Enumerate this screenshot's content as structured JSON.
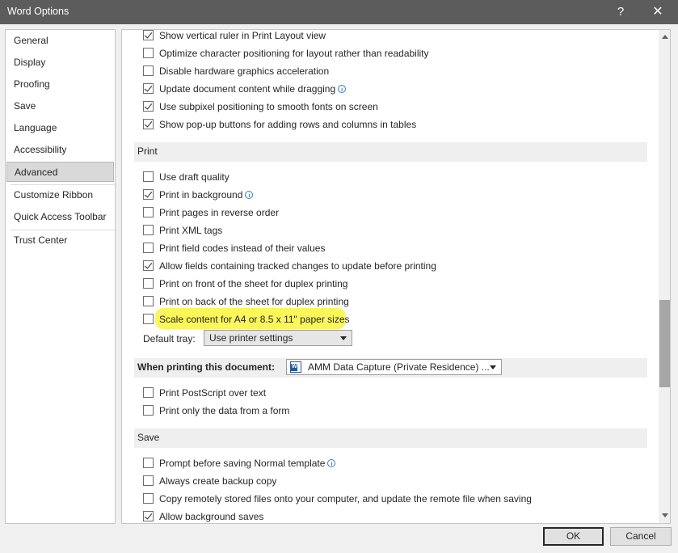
{
  "window": {
    "title": "Word Options",
    "help_glyph": "?",
    "close_glyph": "✕"
  },
  "sidebar": {
    "items": [
      {
        "label": "General",
        "active": false
      },
      {
        "label": "Display",
        "active": false
      },
      {
        "label": "Proofing",
        "active": false
      },
      {
        "label": "Save",
        "active": false
      },
      {
        "label": "Language",
        "active": false
      },
      {
        "label": "Accessibility",
        "active": false
      },
      {
        "label": "Advanced",
        "active": true
      },
      {
        "label": "Customize Ribbon",
        "active": false
      },
      {
        "label": "Quick Access Toolbar",
        "active": false
      },
      {
        "label": "Trust Center",
        "active": false
      }
    ]
  },
  "display_options": [
    {
      "label": "Show vertical ruler in Print Layout view",
      "checked": true,
      "info": false
    },
    {
      "label": "Optimize character positioning for layout rather than readability",
      "checked": false,
      "info": false
    },
    {
      "label": "Disable hardware graphics acceleration",
      "checked": false,
      "info": false
    },
    {
      "label": "Update document content while dragging",
      "checked": true,
      "info": true
    },
    {
      "label": "Use subpixel positioning to smooth fonts on screen",
      "checked": true,
      "info": false
    },
    {
      "label": "Show pop-up buttons for adding rows and columns in tables",
      "checked": true,
      "info": false
    }
  ],
  "print_section": {
    "heading": "Print",
    "options": [
      {
        "label": "Use draft quality",
        "checked": false,
        "info": false
      },
      {
        "label": "Print in background",
        "checked": true,
        "info": true
      },
      {
        "label": "Print pages in reverse order",
        "checked": false,
        "info": false
      },
      {
        "label": "Print XML tags",
        "checked": false,
        "info": false
      },
      {
        "label": "Print field codes instead of their values",
        "checked": false,
        "info": false
      },
      {
        "label": "Allow fields containing tracked changes to update before printing",
        "checked": true,
        "info": false
      },
      {
        "label": "Print on front of the sheet for duplex printing",
        "checked": false,
        "info": false
      },
      {
        "label": "Print on back of the sheet for duplex printing",
        "checked": false,
        "info": false
      },
      {
        "label": "Scale content for A4 or 8.5 x 11\" paper sizes",
        "checked": false,
        "info": false,
        "highlight_color": "#fbf65a"
      }
    ],
    "default_tray_label": "Default tray:",
    "default_tray_value": "Use printer settings"
  },
  "when_printing_section": {
    "heading": "When printing this document:",
    "document_value": "AMM Data Capture (Private Residence) ...",
    "document_icon": "word-document-icon",
    "options": [
      {
        "label": "Print PostScript over text",
        "checked": false
      },
      {
        "label": "Print only the data from a form",
        "checked": false
      }
    ]
  },
  "save_section": {
    "heading": "Save",
    "options": [
      {
        "label": "Prompt before saving Normal template",
        "checked": false,
        "info": true
      },
      {
        "label": "Always create backup copy",
        "checked": false,
        "info": false
      },
      {
        "label": "Copy remotely stored files onto your computer, and update the remote file when saving",
        "checked": false,
        "info": false
      },
      {
        "label": "Allow background saves",
        "checked": true,
        "info": false
      }
    ]
  },
  "footer": {
    "ok_label": "OK",
    "cancel_label": "Cancel"
  },
  "colors": {
    "titlebar": "#5c5c5c",
    "highlight": "#fbf65a",
    "info_icon": "#3a7ac7"
  }
}
